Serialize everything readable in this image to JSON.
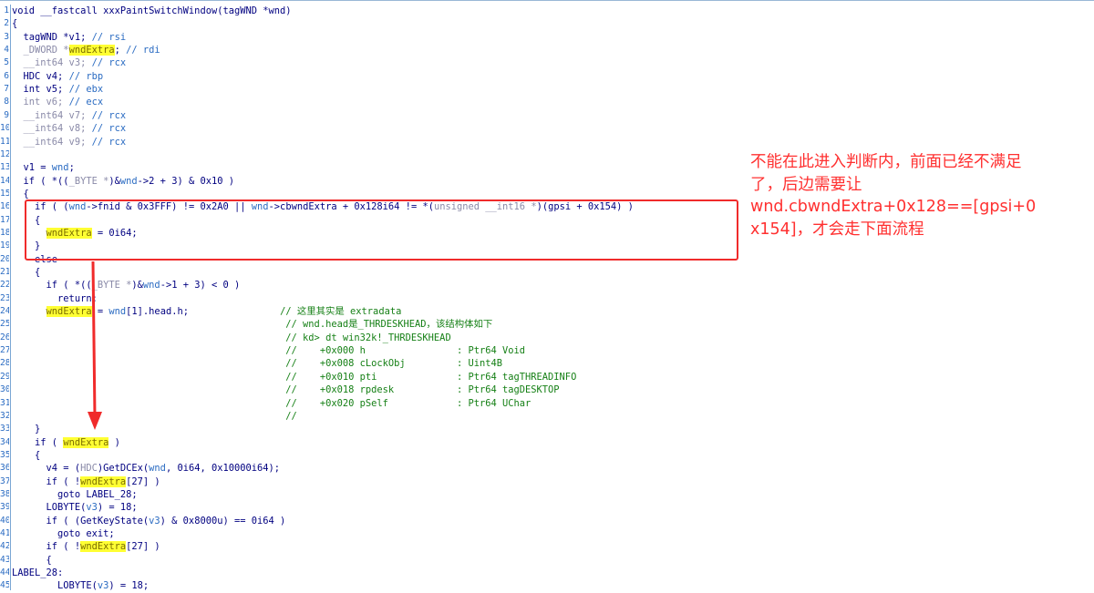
{
  "code": {
    "lines": [
      {
        "n": "1",
        "segs": [
          {
            "t": "void __fastcall xxxPaintSwitchWindow(tagWND *wnd)",
            "c": "plain"
          }
        ]
      },
      {
        "n": "2",
        "segs": [
          {
            "t": "{",
            "c": "plain"
          }
        ]
      },
      {
        "n": "3",
        "segs": [
          {
            "t": "  tagWND *v1; ",
            "c": "plain"
          },
          {
            "t": "// rsi",
            "c": "blue"
          }
        ]
      },
      {
        "n": "4",
        "segs": [
          {
            "t": "  _DWORD *",
            "c": "gray"
          },
          {
            "t": "wndExtra",
            "c": "hl"
          },
          {
            "t": "; ",
            "c": "plain"
          },
          {
            "t": "// rdi",
            "c": "blue"
          }
        ]
      },
      {
        "n": "5",
        "segs": [
          {
            "t": "  __int64 v3; ",
            "c": "gray"
          },
          {
            "t": "// rcx",
            "c": "blue"
          }
        ]
      },
      {
        "n": "6",
        "segs": [
          {
            "t": "  HDC v4; ",
            "c": "plain"
          },
          {
            "t": "// rbp",
            "c": "blue"
          }
        ]
      },
      {
        "n": "7",
        "segs": [
          {
            "t": "  int v5; ",
            "c": "plain"
          },
          {
            "t": "// ebx",
            "c": "blue"
          }
        ]
      },
      {
        "n": "8",
        "segs": [
          {
            "t": "  int v6; ",
            "c": "gray"
          },
          {
            "t": "// ecx",
            "c": "blue"
          }
        ]
      },
      {
        "n": "9",
        "segs": [
          {
            "t": "  __int64 v7; ",
            "c": "gray"
          },
          {
            "t": "// rcx",
            "c": "blue"
          }
        ]
      },
      {
        "n": "10",
        "segs": [
          {
            "t": "  __int64 v8; ",
            "c": "gray"
          },
          {
            "t": "// rcx",
            "c": "blue"
          }
        ]
      },
      {
        "n": "11",
        "segs": [
          {
            "t": "  __int64 v9; ",
            "c": "gray"
          },
          {
            "t": "// rcx",
            "c": "blue"
          }
        ]
      },
      {
        "n": "12",
        "segs": [
          {
            "t": "",
            "c": "plain"
          }
        ]
      },
      {
        "n": "13",
        "segs": [
          {
            "t": "  v1 = ",
            "c": "plain"
          },
          {
            "t": "wnd",
            "c": "blue"
          },
          {
            "t": ";",
            "c": "plain"
          }
        ]
      },
      {
        "n": "14",
        "segs": [
          {
            "t": "  if ( *((",
            "c": "plain"
          },
          {
            "t": "_BYTE *",
            "c": "gray"
          },
          {
            "t": ")&",
            "c": "plain"
          },
          {
            "t": "wnd",
            "c": "blue"
          },
          {
            "t": "->2 + 3) & 0x10 )",
            "c": "plain"
          }
        ]
      },
      {
        "n": "15",
        "segs": [
          {
            "t": "  {",
            "c": "plain"
          }
        ]
      },
      {
        "n": "16",
        "segs": [
          {
            "t": "    if ( (",
            "c": "plain"
          },
          {
            "t": "wnd",
            "c": "blue"
          },
          {
            "t": "->fnid & 0x3FFF) != 0x2A0 || ",
            "c": "plain"
          },
          {
            "t": "wnd",
            "c": "blue"
          },
          {
            "t": "->cbwndExtra + 0x128i64 != *(",
            "c": "plain"
          },
          {
            "t": "unsigned __int16 *",
            "c": "gray"
          },
          {
            "t": ")(gpsi + 0x154) )",
            "c": "plain"
          }
        ]
      },
      {
        "n": "17",
        "segs": [
          {
            "t": "    {",
            "c": "plain"
          }
        ]
      },
      {
        "n": "18",
        "segs": [
          {
            "t": "      ",
            "c": "plain"
          },
          {
            "t": "wndExtra",
            "c": "hl"
          },
          {
            "t": " = 0i64;",
            "c": "plain"
          }
        ]
      },
      {
        "n": "19",
        "segs": [
          {
            "t": "    }",
            "c": "plain"
          }
        ]
      },
      {
        "n": "20",
        "segs": [
          {
            "t": "    else",
            "c": "plain"
          }
        ]
      },
      {
        "n": "21",
        "segs": [
          {
            "t": "    {",
            "c": "plain"
          }
        ]
      },
      {
        "n": "22",
        "segs": [
          {
            "t": "      if ( *((",
            "c": "plain"
          },
          {
            "t": "_BYTE *",
            "c": "gray"
          },
          {
            "t": ")&",
            "c": "plain"
          },
          {
            "t": "wnd",
            "c": "blue"
          },
          {
            "t": "->1 + 3) < 0 )",
            "c": "plain"
          }
        ]
      },
      {
        "n": "23",
        "segs": [
          {
            "t": "        return;",
            "c": "plain"
          }
        ]
      },
      {
        "n": "24",
        "segs": [
          {
            "t": "      ",
            "c": "plain"
          },
          {
            "t": "wndExtra",
            "c": "hl"
          },
          {
            "t": " = ",
            "c": "plain"
          },
          {
            "t": "wnd",
            "c": "blue"
          },
          {
            "t": "[1].head.h;                ",
            "c": "plain"
          },
          {
            "t": "// 这里其实是 extradata",
            "c": "cmt"
          }
        ]
      },
      {
        "n": "25",
        "segs": [
          {
            "t": "                                                ",
            "c": "plain"
          },
          {
            "t": "// wnd.head是_THRDESKHEAD，该结构体如下",
            "c": "cmt"
          }
        ]
      },
      {
        "n": "26",
        "segs": [
          {
            "t": "                                                ",
            "c": "plain"
          },
          {
            "t": "// kd> dt win32k!_THRDESKHEAD",
            "c": "cmt"
          }
        ]
      },
      {
        "n": "27",
        "segs": [
          {
            "t": "                                                ",
            "c": "plain"
          },
          {
            "t": "//    +0x000 h                : Ptr64 Void",
            "c": "cmt"
          }
        ]
      },
      {
        "n": "28",
        "segs": [
          {
            "t": "                                                ",
            "c": "plain"
          },
          {
            "t": "//    +0x008 cLockObj         : Uint4B",
            "c": "cmt"
          }
        ]
      },
      {
        "n": "29",
        "segs": [
          {
            "t": "                                                ",
            "c": "plain"
          },
          {
            "t": "//    +0x010 pti              : Ptr64 tagTHREADINFO",
            "c": "cmt"
          }
        ]
      },
      {
        "n": "30",
        "segs": [
          {
            "t": "                                                ",
            "c": "plain"
          },
          {
            "t": "//    +0x018 rpdesk           : Ptr64 tagDESKTOP",
            "c": "cmt"
          }
        ]
      },
      {
        "n": "31",
        "segs": [
          {
            "t": "                                                ",
            "c": "plain"
          },
          {
            "t": "//    +0x020 pSelf            : Ptr64 UChar",
            "c": "cmt"
          }
        ]
      },
      {
        "n": "32",
        "segs": [
          {
            "t": "                                                ",
            "c": "plain"
          },
          {
            "t": "//",
            "c": "cmt"
          }
        ]
      },
      {
        "n": "33",
        "segs": [
          {
            "t": "    }",
            "c": "plain"
          }
        ]
      },
      {
        "n": "34",
        "segs": [
          {
            "t": "    if ( ",
            "c": "plain"
          },
          {
            "t": "wndExtra",
            "c": "hl"
          },
          {
            "t": " )",
            "c": "plain"
          }
        ]
      },
      {
        "n": "35",
        "segs": [
          {
            "t": "    {",
            "c": "plain"
          }
        ]
      },
      {
        "n": "36",
        "segs": [
          {
            "t": "      v4 = (",
            "c": "plain"
          },
          {
            "t": "HDC",
            "c": "gray"
          },
          {
            "t": ")GetDCEx(",
            "c": "plain"
          },
          {
            "t": "wnd",
            "c": "blue"
          },
          {
            "t": ", 0i64, 0x10000i64);",
            "c": "plain"
          }
        ]
      },
      {
        "n": "37",
        "segs": [
          {
            "t": "      if ( !",
            "c": "plain"
          },
          {
            "t": "wndExtra",
            "c": "hl"
          },
          {
            "t": "[27] )",
            "c": "plain"
          }
        ]
      },
      {
        "n": "38",
        "segs": [
          {
            "t": "        goto LABEL_28;",
            "c": "plain"
          }
        ]
      },
      {
        "n": "39",
        "segs": [
          {
            "t": "      LOBYTE(",
            "c": "plain"
          },
          {
            "t": "v3",
            "c": "blue"
          },
          {
            "t": ") = 18;",
            "c": "plain"
          }
        ]
      },
      {
        "n": "40",
        "segs": [
          {
            "t": "      if ( (GetKeyState(",
            "c": "plain"
          },
          {
            "t": "v3",
            "c": "blue"
          },
          {
            "t": ") & 0x8000u) == 0i64 )",
            "c": "plain"
          }
        ]
      },
      {
        "n": "41",
        "segs": [
          {
            "t": "        goto exit;",
            "c": "plain"
          }
        ]
      },
      {
        "n": "42",
        "segs": [
          {
            "t": "      if ( !",
            "c": "plain"
          },
          {
            "t": "wndExtra",
            "c": "hl"
          },
          {
            "t": "[27] )",
            "c": "plain"
          }
        ]
      },
      {
        "n": "43",
        "segs": [
          {
            "t": "      {",
            "c": "plain"
          }
        ]
      },
      {
        "n": "44",
        "segs": [
          {
            "t": "LABEL_28:",
            "c": "plain"
          }
        ]
      },
      {
        "n": "45",
        "segs": [
          {
            "t": "        LOBYTE(",
            "c": "plain"
          },
          {
            "t": "v3",
            "c": "blue"
          },
          {
            "t": ") = 18;",
            "c": "plain"
          }
        ]
      }
    ]
  },
  "annotation": {
    "lines": [
      "不能在此进入判断内，前面已经不满足",
      "了，后边需要让",
      "wnd.cbwndExtra+0x128==[gpsi+0",
      "x154]，才会走下面流程"
    ],
    "color": "#ff3030"
  },
  "colors": {
    "highlight": "#ffff33",
    "box": "#f02b2b",
    "comment": "#168016"
  }
}
